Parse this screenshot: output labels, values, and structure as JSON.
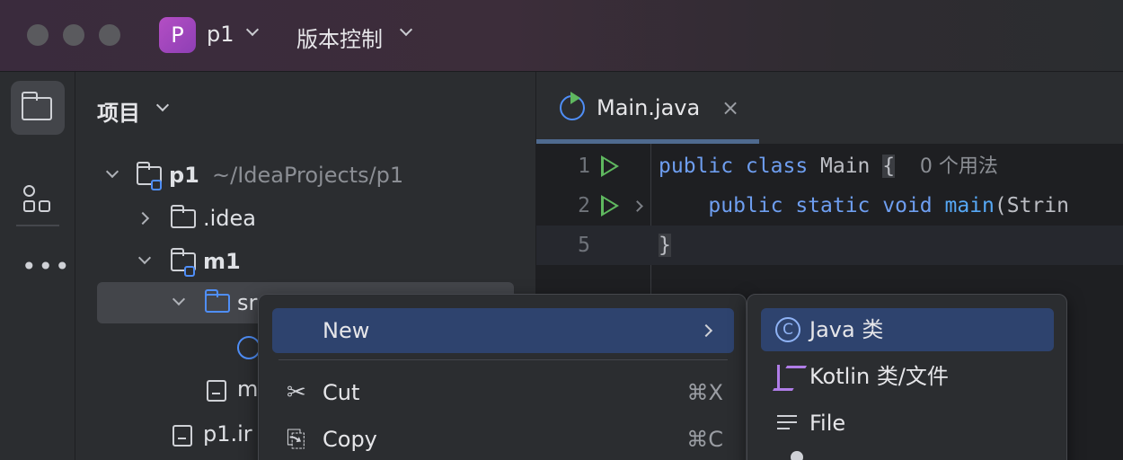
{
  "titlebar": {
    "project_badge": "P",
    "project_name": "p1",
    "vcs_label": "版本控制"
  },
  "toolstrip": {
    "items": [
      "project-tool",
      "structure-tool",
      "more-tools"
    ],
    "more_glyph": "•••"
  },
  "project_panel": {
    "title": "项目",
    "tree": [
      {
        "label": "p1",
        "sub": "~/IdeaProjects/p1",
        "expanded": true
      },
      {
        "label": ".idea",
        "expanded": false
      },
      {
        "label": "m1",
        "expanded": true
      },
      {
        "label": "sr",
        "expanded": true,
        "selected": true
      },
      {
        "label": "m"
      },
      {
        "label": "p1.ir"
      }
    ]
  },
  "editor": {
    "tab_label": "Main.java",
    "tab_close": "×",
    "lines": [
      {
        "num": "1",
        "kw": "public class",
        "name": " Main ",
        "brace": "{",
        "hint": "0 个用法"
      },
      {
        "num": "2",
        "kw": "public static void",
        "fn": "main",
        "rest": "(Strin"
      },
      {
        "num": "5",
        "brace": "}"
      }
    ]
  },
  "context_menu": {
    "items": [
      {
        "label": "New",
        "submenu": true
      },
      {
        "label": "Cut",
        "shortcut": "⌘X",
        "icon": "scissors-icon",
        "glyph": "✂"
      },
      {
        "label": "Copy",
        "shortcut": "⌘C",
        "icon": "copy-icon",
        "glyph": "⎘"
      }
    ]
  },
  "submenu": {
    "items": [
      {
        "label": "Java 类",
        "icon": "java-class-icon",
        "glyph": "C"
      },
      {
        "label": "Kotlin 类/文件",
        "icon": "kotlin-icon"
      },
      {
        "label": "File",
        "icon": "file-lines-icon"
      }
    ]
  },
  "colors": {
    "accent": "#4f8ef7",
    "selection": "#2e436e",
    "run_green": "#5fb85f",
    "badge_purple": "#b44ec4"
  }
}
